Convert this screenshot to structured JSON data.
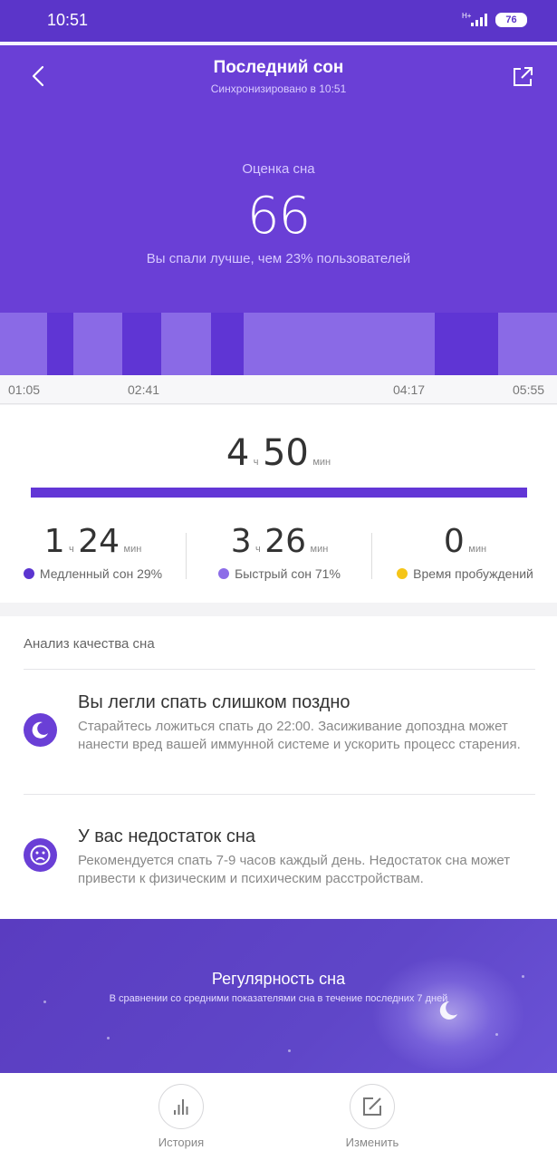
{
  "status_bar": {
    "time": "10:51",
    "network": "H+",
    "battery": "76"
  },
  "header": {
    "title": "Последний сон",
    "subtitle": "Синхронизировано в 10:51",
    "back_icon": "chevron-left-icon",
    "share_icon": "share-icon"
  },
  "score": {
    "label": "Оценка сна",
    "value": "66",
    "comparison": "Вы спали лучше, чем 23% пользователей"
  },
  "timeline": {
    "colors": {
      "light": "#8a6ae6",
      "deep": "#5f35d4"
    },
    "axis_labels": [
      "01:05",
      "02:41",
      "04:17",
      "05:55"
    ]
  },
  "summary": {
    "total": {
      "hours": "4",
      "hours_unit": "ч",
      "minutes": "50",
      "minutes_unit": "мин"
    },
    "bar_fill_fraction": 1,
    "breakdown": [
      {
        "hours": "1",
        "hours_unit": "ч",
        "minutes": "24",
        "minutes_unit": "мин",
        "label": "Медленный сон 29%",
        "color": "#5b35d0"
      },
      {
        "hours": "3",
        "hours_unit": "ч",
        "minutes": "26",
        "minutes_unit": "мин",
        "label": "Быстрый сон 71%",
        "color": "#8c6ce8"
      },
      {
        "minutes": "0",
        "minutes_unit": "мин",
        "label": "Время пробуждений",
        "color": "#f5c518"
      }
    ]
  },
  "analysis": {
    "heading": "Анализ качества сна",
    "items": [
      {
        "icon": "moon-icon",
        "title": "Вы легли спать слишком поздно",
        "description": "Старайтесь ложиться спать до 22:00. Засиживание допоздна может нанести вред вашей иммунной системе и ускорить процесс старения."
      },
      {
        "icon": "sad-face-icon",
        "title": "У вас недостаток сна",
        "description": "Рекомендуется спать 7-9 часов каждый день. Недостаток сна может привести к физическим и психическим расстройствам."
      }
    ]
  },
  "regularity": {
    "title": "Регулярность сна",
    "subtitle": "В сравнении со средними показателями сна в течение последних 7 дней"
  },
  "bottom_bar": {
    "history": {
      "label": "История",
      "icon": "bar-chart-icon"
    },
    "edit": {
      "label": "Изменить",
      "icon": "edit-icon"
    }
  }
}
